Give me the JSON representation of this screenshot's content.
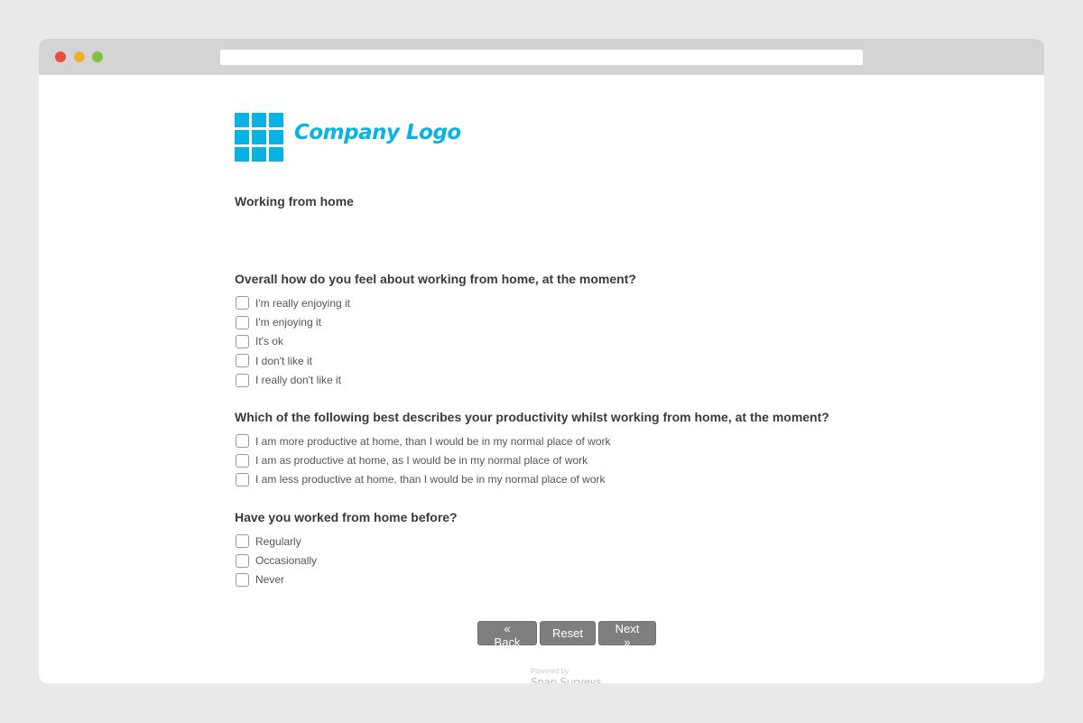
{
  "browser": {
    "window_controls": [
      "close",
      "minimize",
      "maximize"
    ],
    "url": ""
  },
  "logo": {
    "text": "Company Logo",
    "color": "#08b2e3"
  },
  "survey": {
    "section_title": "Working from home",
    "questions": [
      {
        "text": "Overall how do you feel about working from home, at the moment?",
        "options": [
          {
            "label": "I'm really enjoying it",
            "checked": false
          },
          {
            "label": "I'm enjoying it",
            "checked": false
          },
          {
            "label": "It's ok",
            "checked": false
          },
          {
            "label": "I don't like it",
            "checked": false
          },
          {
            "label": "I really don't like it",
            "checked": false
          }
        ]
      },
      {
        "text": "Which of the following best describes your productivity whilst working from home, at the moment?",
        "options": [
          {
            "label": "I am more productive at home, than I would be in my normal place of work",
            "checked": false
          },
          {
            "label": "I am as productive at home, as I would be in my normal place of work",
            "checked": false
          },
          {
            "label": "I am less productive at home, than I would be in my normal place of work",
            "checked": false
          }
        ]
      },
      {
        "text": "Have you worked from home before?",
        "options": [
          {
            "label": "Regularly",
            "checked": false
          },
          {
            "label": "Occasionally",
            "checked": false
          },
          {
            "label": "Never",
            "checked": false
          }
        ]
      }
    ]
  },
  "navigation": {
    "back_label": "« Back",
    "reset_label": "Reset",
    "next_label": "Next »"
  },
  "footer": {
    "powered_by": "Powered by",
    "brand": "Snap Surveys"
  }
}
